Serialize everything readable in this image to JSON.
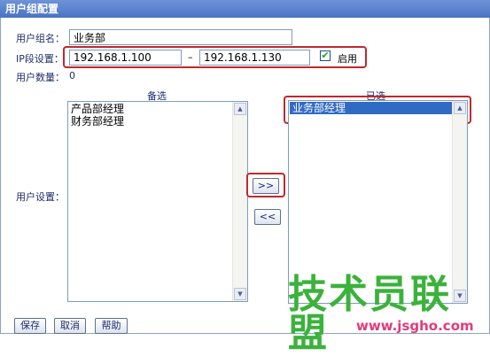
{
  "window": {
    "title": "用户组配置"
  },
  "form": {
    "group_name_label": "用户组名：",
    "group_name_value": "业务部",
    "ip_label": "IP段设置：",
    "ip_start": "192.168.1.100",
    "ip_separator": "–",
    "ip_end": "192.168.1.130",
    "enable_label": "启用",
    "enable_checked": true,
    "user_count_label": "用户数量：",
    "user_count_value": "0",
    "user_setting_label": "用户设置："
  },
  "lists": {
    "available_title": "备选",
    "available_items": [
      "产品部经理",
      "财务部经理"
    ],
    "selected_title": "已选",
    "selected_items": [
      "业务部经理"
    ]
  },
  "transfer": {
    "add_label": ">>",
    "remove_label": "<<"
  },
  "footer": {
    "save_label": "保存",
    "cancel_label": "取消",
    "help_label": "帮助"
  },
  "watermark": {
    "main": "技术员联盟",
    "url": "www.jsgho.com"
  },
  "colors": {
    "title_bar": "#5b80cc",
    "highlight_box": "#c0282d",
    "selection": "#316ac5",
    "watermark_green": "#3bb23b",
    "watermark_pink": "#e23b7a"
  }
}
